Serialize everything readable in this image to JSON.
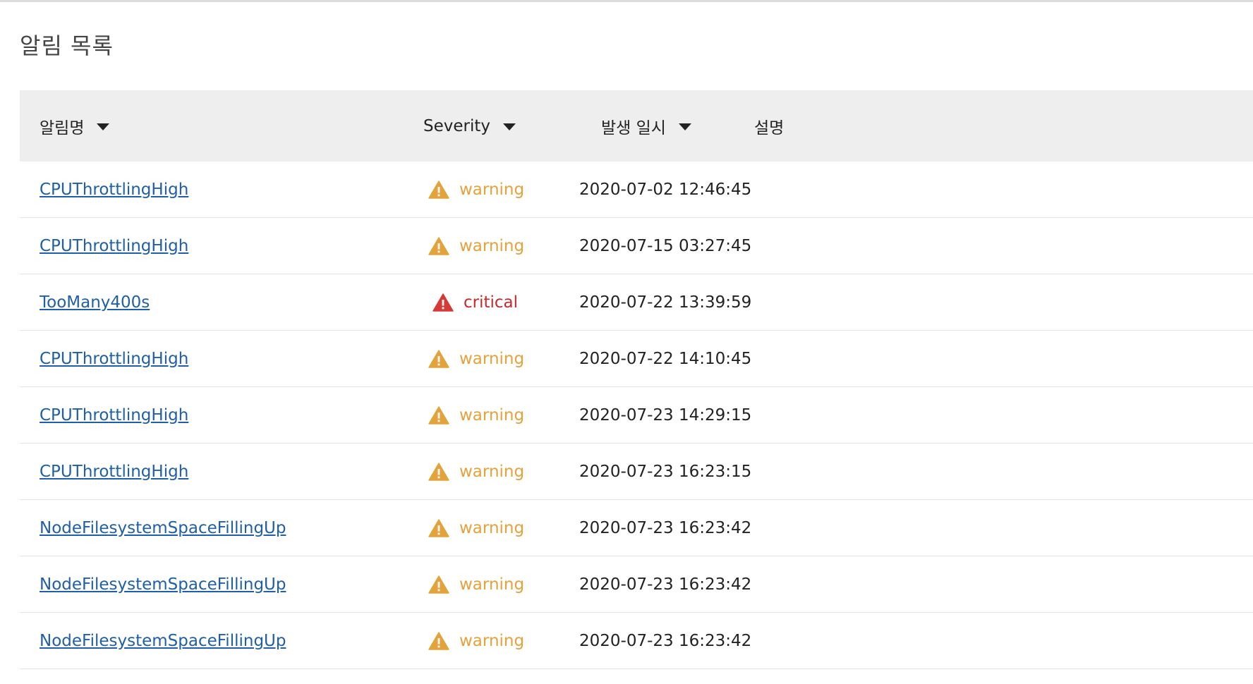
{
  "page": {
    "title": "알림 목록"
  },
  "table": {
    "columns": [
      {
        "label": "알림명",
        "sortable": true
      },
      {
        "label": "Severity",
        "sortable": true
      },
      {
        "label": "발생 일시",
        "sortable": true
      },
      {
        "label": "설명",
        "sortable": false
      }
    ],
    "rows": [
      {
        "name": "CPUThrottlingHigh",
        "severity": "warning",
        "time": "2020-07-02 12:46:45",
        "description": ""
      },
      {
        "name": "CPUThrottlingHigh",
        "severity": "warning",
        "time": "2020-07-15 03:27:45",
        "description": ""
      },
      {
        "name": "TooMany400s",
        "severity": "critical",
        "time": "2020-07-22 13:39:59",
        "description": ""
      },
      {
        "name": "CPUThrottlingHigh",
        "severity": "warning",
        "time": "2020-07-22 14:10:45",
        "description": ""
      },
      {
        "name": "CPUThrottlingHigh",
        "severity": "warning",
        "time": "2020-07-23 14:29:15",
        "description": ""
      },
      {
        "name": "CPUThrottlingHigh",
        "severity": "warning",
        "time": "2020-07-23 16:23:15",
        "description": ""
      },
      {
        "name": "NodeFilesystemSpaceFillingUp",
        "severity": "warning",
        "time": "2020-07-23 16:23:42",
        "description": ""
      },
      {
        "name": "NodeFilesystemSpaceFillingUp",
        "severity": "warning",
        "time": "2020-07-23 16:23:42",
        "description": ""
      },
      {
        "name": "NodeFilesystemSpaceFillingUp",
        "severity": "warning",
        "time": "2020-07-23 16:23:42",
        "description": ""
      }
    ]
  },
  "severity_styles": {
    "warning": {
      "icon": "warning-triangle-icon",
      "color": "#e4a33a"
    },
    "critical": {
      "icon": "critical-triangle-icon",
      "color": "#d63a36"
    }
  }
}
